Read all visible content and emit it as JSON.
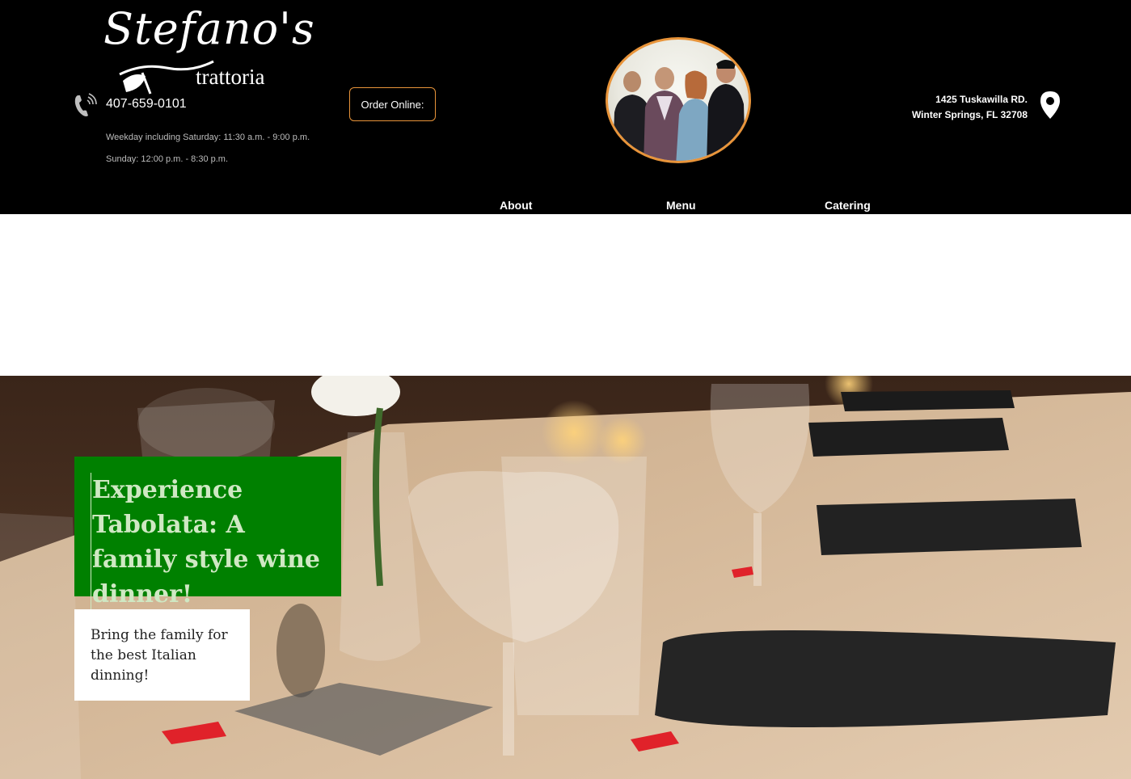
{
  "header": {
    "logo": {
      "script": "Stefano's",
      "sub": "trattoria"
    },
    "phone": "407-659-0101",
    "hours": [
      "Weekday including Saturday: 11:30 a.m. - 9:00 p.m.",
      "Sunday: 12:00 p.m. - 8:30 p.m."
    ],
    "order_button": "Order Online:",
    "address": {
      "line1": "1425 Tuskawilla RD.",
      "line2": "Winter Springs, FL 32708"
    }
  },
  "nav": {
    "items": [
      "About",
      "Menu",
      "Catering"
    ]
  },
  "hero": {
    "title": "Experience Tabolata: A family style wine dinner!",
    "subtitle": "Bring the family for the best Italian dinning!"
  },
  "colors": {
    "header_bg": "#000000",
    "accent_orange": "#e8943a",
    "promo_green": "#008000",
    "promo_text": "#cfe8c3"
  }
}
